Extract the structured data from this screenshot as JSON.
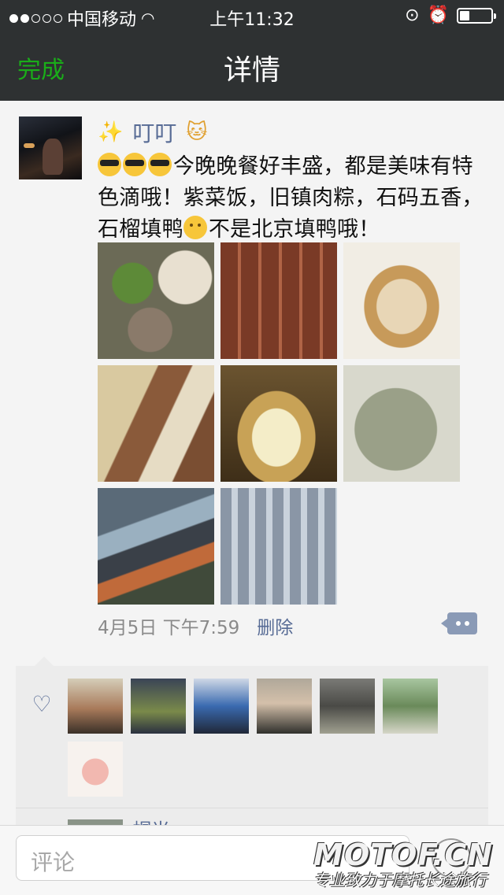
{
  "status_bar": {
    "carrier": "中国移动",
    "time": "上午11:32"
  },
  "nav": {
    "done_label": "完成",
    "title": "详情"
  },
  "post": {
    "author": "叮叮",
    "text_line1": "今晚晚餐好丰盛，都是美味有特色滴哦！紫菜饭，旧镇肉粽，石码五香，石榴填鸭",
    "text_line2": "不是北京填鸭哦！",
    "images": [
      "dinner-table",
      "meat-rolls",
      "steamed-fish",
      "braised-duck",
      "rice-dumpling",
      "seaweed-rice",
      "seafood-market",
      "fish-trays"
    ],
    "timestamp": "4月5日 下午7:59",
    "delete_label": "删除"
  },
  "likes": {
    "count_shown": 7
  },
  "comment_preview": {
    "name": "帽光"
  },
  "input": {
    "placeholder": "评论"
  },
  "watermark": {
    "logo": "MOTOF.CN",
    "slogan": "专业致力于摩托长途旅行"
  },
  "colors": {
    "bar": "#2e3132",
    "accent": "#1aad19",
    "link": "#576b95"
  }
}
